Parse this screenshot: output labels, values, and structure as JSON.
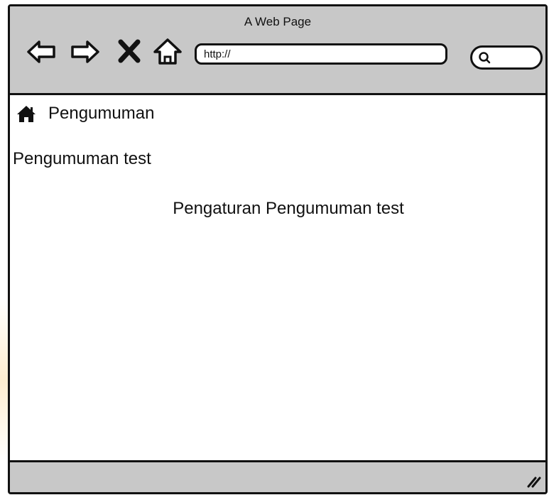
{
  "window": {
    "title": "A Web Page"
  },
  "toolbar": {
    "back_icon": "back-arrow-icon",
    "forward_icon": "forward-arrow-icon",
    "stop_icon": "close-icon",
    "home_icon": "home-outline-icon",
    "url": "http://",
    "search_icon": "search-icon"
  },
  "content": {
    "breadcrumb": {
      "icon": "home-icon",
      "label": "Pengumuman"
    },
    "heading": "Pengumuman test",
    "center_text": "Pengaturan Pengumuman test"
  },
  "statusbar": {
    "grip_icon": "resize-grip-icon"
  },
  "colors": {
    "chrome": "#c8c8c8",
    "border": "#111111",
    "background": "#ffffff"
  }
}
